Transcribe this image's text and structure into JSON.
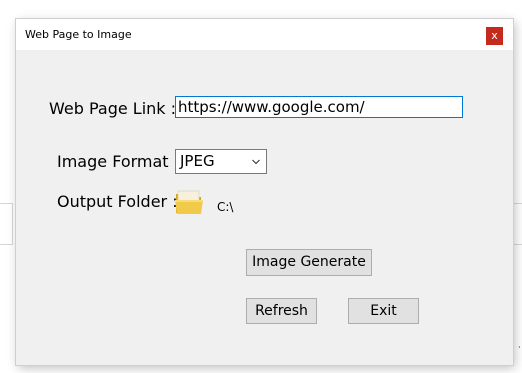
{
  "window": {
    "title": "Web Page to Image",
    "close_glyph": "x"
  },
  "form": {
    "link_label": "Web Page Link :",
    "link_value": "https://www.google.com/",
    "format_label": "Image Format :",
    "format_value": "JPEG",
    "folder_label": "Output Folder :",
    "folder_path": "C:\\"
  },
  "buttons": {
    "generate": "Image Generate",
    "refresh": "Refresh",
    "exit": "Exit"
  },
  "background": {
    "link_fragment": "o",
    "trailing_fragment": "˙"
  },
  "colors": {
    "close_red": "#c42b1c",
    "focus_blue": "#0078d7",
    "dialog_bg": "#f0f0f0"
  },
  "icons": [
    "close-icon",
    "chevron-down-icon",
    "folder-icon"
  ]
}
